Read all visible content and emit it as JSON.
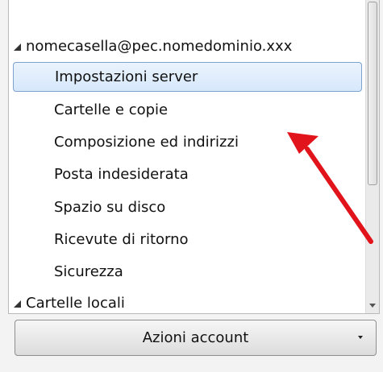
{
  "account_tree": {
    "account": {
      "label": "nomecasella@pec.nomedominio.xxx",
      "expanded": true,
      "items": [
        {
          "label": "Impostazioni server",
          "selected": true
        },
        {
          "label": "Cartelle e copie",
          "selected": false
        },
        {
          "label": "Composizione ed indirizzi",
          "selected": false
        },
        {
          "label": "Posta indesiderata",
          "selected": false
        },
        {
          "label": "Spazio su disco",
          "selected": false
        },
        {
          "label": "Ricevute di ritorno",
          "selected": false
        },
        {
          "label": "Sicurezza",
          "selected": false
        }
      ]
    },
    "local_folders": {
      "label": "Cartelle locali",
      "expanded": true
    }
  },
  "account_actions": {
    "label": "Azioni account"
  },
  "annotation": {
    "color": "#e0141a",
    "icon": "red-arrow-annotation"
  },
  "colors": {
    "selection_border": "#7da2ce",
    "selection_fill": "#dbeafc"
  }
}
